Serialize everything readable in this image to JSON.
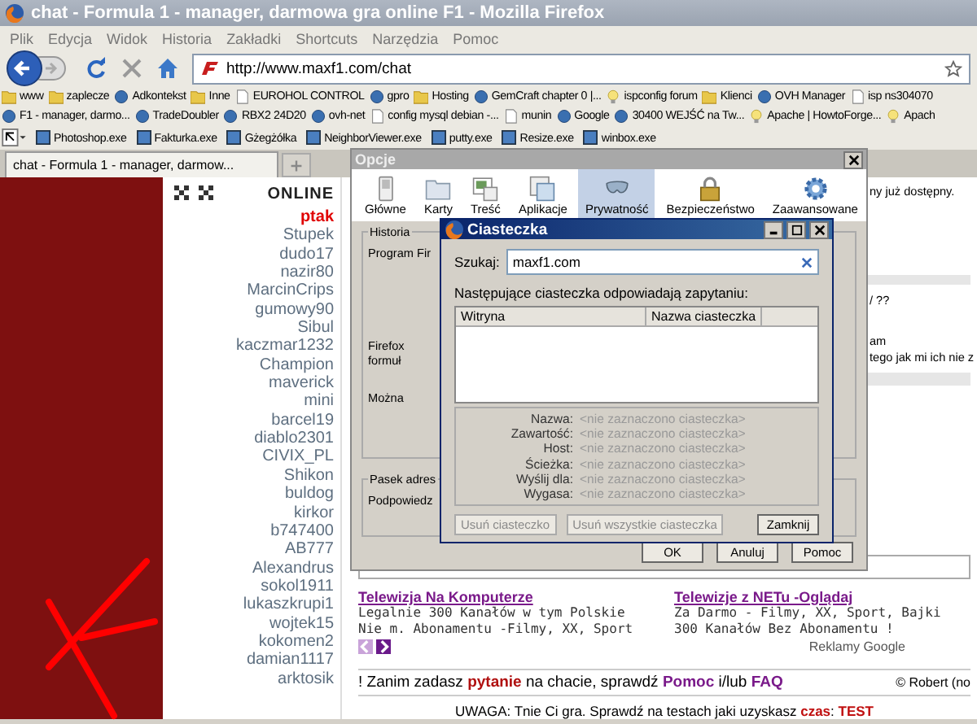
{
  "window": {
    "title": "chat - Formula 1 - manager, darmowa gra online F1 - Mozilla Firefox"
  },
  "menu": [
    "Plik",
    "Edycja",
    "Widok",
    "Historia",
    "Zakładki",
    "Shortcuts",
    "Narzędzia",
    "Pomoc"
  ],
  "nav": {
    "url": "http://www.maxf1.com/chat"
  },
  "bookmarks": [
    {
      "label": "www",
      "kind": "folder"
    },
    {
      "label": "zaplecze",
      "kind": "folder"
    },
    {
      "label": "Adkontekst",
      "kind": "site"
    },
    {
      "label": "Inne",
      "kind": "folder"
    },
    {
      "label": "EUROHOL CONTROL",
      "kind": "page"
    },
    {
      "label": "gpro",
      "kind": "site"
    },
    {
      "label": "Hosting",
      "kind": "folder"
    },
    {
      "label": "GemCraft chapter 0 |...",
      "kind": "site"
    },
    {
      "label": "ispconfig forum",
      "kind": "bulb"
    },
    {
      "label": "Klienci",
      "kind": "folder"
    },
    {
      "label": "OVH Manager",
      "kind": "site"
    },
    {
      "label": "isp ns304070",
      "kind": "page"
    }
  ],
  "bookmarks_2": [
    {
      "label": "F1 - manager, darmo...",
      "kind": "site"
    },
    {
      "label": "TradeDoubler",
      "kind": "site"
    },
    {
      "label": "RBX2 24D20",
      "kind": "site"
    },
    {
      "label": "ovh-net",
      "kind": "site"
    },
    {
      "label": "config mysql debian -...",
      "kind": "page"
    },
    {
      "label": "munin",
      "kind": "page"
    },
    {
      "label": "Google",
      "kind": "site"
    },
    {
      "label": "30400 WEJŚĆ na Tw...",
      "kind": "site"
    },
    {
      "label": "Apache | HowtoForge...",
      "kind": "bulb"
    },
    {
      "label": "Apach",
      "kind": "bulb"
    }
  ],
  "quick_launch": [
    "Photoshop.exe",
    "Fakturka.exe",
    "Gżegżółka",
    "NeighborViewer.exe",
    "putty.exe",
    "Resize.exe",
    "winbox.exe"
  ],
  "tabs": [
    {
      "label": "chat - Formula 1 - manager, darmow...",
      "selected": true
    }
  ],
  "online": {
    "title": "ONLINE",
    "users": [
      {
        "name": "ptak",
        "selected": true
      },
      {
        "name": "Stupek",
        "selected": false
      },
      {
        "name": "dudo17",
        "selected": false
      },
      {
        "name": "nazir80",
        "selected": false
      },
      {
        "name": "MarcinCrips",
        "selected": false
      },
      {
        "name": "gumowy90",
        "selected": false
      },
      {
        "name": "Sibul",
        "selected": false
      },
      {
        "name": "kaczmar1232",
        "selected": false
      },
      {
        "name": "Champion",
        "selected": false
      },
      {
        "name": "maverick",
        "selected": false
      },
      {
        "name": "mini",
        "selected": false
      },
      {
        "name": "barcel19",
        "selected": false
      },
      {
        "name": "diablo2301",
        "selected": false
      },
      {
        "name": "CIVIX_PL",
        "selected": false
      },
      {
        "name": "Shikon",
        "selected": false
      },
      {
        "name": "buldog",
        "selected": false
      },
      {
        "name": "kirkor",
        "selected": false
      },
      {
        "name": "b747400",
        "selected": false
      },
      {
        "name": "AB777",
        "selected": false
      },
      {
        "name": "Alexandrus",
        "selected": false
      },
      {
        "name": "sokol1911",
        "selected": false
      },
      {
        "name": "lukaszkrupi1",
        "selected": false
      },
      {
        "name": "wojtek15",
        "selected": false
      },
      {
        "name": "kokomen2",
        "selected": false
      },
      {
        "name": "damian1117",
        "selected": false
      },
      {
        "name": "arktosik",
        "selected": false
      }
    ]
  },
  "chat": {
    "fragments": [
      "ny już dostępny.",
      "/ ??",
      "am",
      "tego jak mi ich nie z"
    ],
    "ads": [
      {
        "title": "Telewizja Na Komputerze",
        "text": "Legalnie 300 Kanałów w tym Polskie Nie m. Abonamentu -Filmy, XX, Sport"
      },
      {
        "title": "Telewizje z NETu -Oglądaj",
        "text": "Za Darmo - Filmy, XX, Sport, Bajki 300 Kanałów Bez Abonamentu !"
      }
    ],
    "ads_label": "Reklamy Google",
    "tip": [
      {
        "kind": "text",
        "text": "! Zanim zadasz "
      },
      {
        "kind": "link",
        "text": "pytanie"
      },
      {
        "kind": "text",
        "text": " na chacie, sprawdź "
      },
      {
        "kind": "link",
        "text": "Pomoc"
      },
      {
        "kind": "text",
        "text": " i/lub "
      },
      {
        "kind": "link",
        "text": "FAQ"
      }
    ],
    "copyright": "© Robert (no",
    "warning": [
      {
        "kind": "text",
        "text": "UWAGA: Tnie Ci gra. Sprawdź na testach jaki uzyskasz "
      },
      {
        "kind": "link",
        "text": "czas"
      },
      {
        "kind": "text",
        "text": ": "
      },
      {
        "kind": "link",
        "text": "TEST"
      }
    ]
  },
  "options_dialog": {
    "title": "Opcje",
    "panes": [
      {
        "label": "Główne",
        "selected": false
      },
      {
        "label": "Karty",
        "selected": false
      },
      {
        "label": "Treść",
        "selected": false
      },
      {
        "label": "Aplikacje",
        "selected": false
      },
      {
        "label": "Prywatność",
        "selected": true
      },
      {
        "label": "Bezpieczeństwo",
        "selected": false
      },
      {
        "label": "Zaawansowane",
        "selected": false
      }
    ],
    "history_group": "Historia",
    "history_lines": [
      "Program Fir",
      "Firefox",
      "formuł",
      "Można"
    ],
    "address_group": "Pasek adres",
    "address_line": "Podpowiedz",
    "buttons": [
      "OK",
      "Anuluj",
      "Pomoc"
    ]
  },
  "cookies_dialog": {
    "title": "Ciasteczka",
    "search_label": "Szukaj:",
    "search_value": "maxf1.com",
    "caption": "Następujące ciasteczka odpowiadają zapytaniu:",
    "columns": [
      "Witryna",
      "Nazwa ciasteczka"
    ],
    "details": [
      {
        "label": "Nazwa:",
        "value": "<nie zaznaczono ciasteczka>"
      },
      {
        "label": "Zawartość:",
        "value": "<nie zaznaczono ciasteczka>"
      },
      {
        "label": "Host:",
        "value": "<nie zaznaczono ciasteczka>"
      },
      {
        "label": "Ścieżka:",
        "value": "<nie zaznaczono ciasteczka>"
      },
      {
        "label": "Wyślij dla:",
        "value": "<nie zaznaczono ciasteczka>"
      },
      {
        "label": "Wygasa:",
        "value": "<nie zaznaczono ciasteczka>"
      }
    ],
    "buttons": [
      {
        "label": "Usuń ciasteczko",
        "disabled": true
      },
      {
        "label": "Usuń wszystkie ciasteczka",
        "disabled": true
      },
      {
        "label": "Zamknij",
        "disabled": false
      }
    ]
  }
}
